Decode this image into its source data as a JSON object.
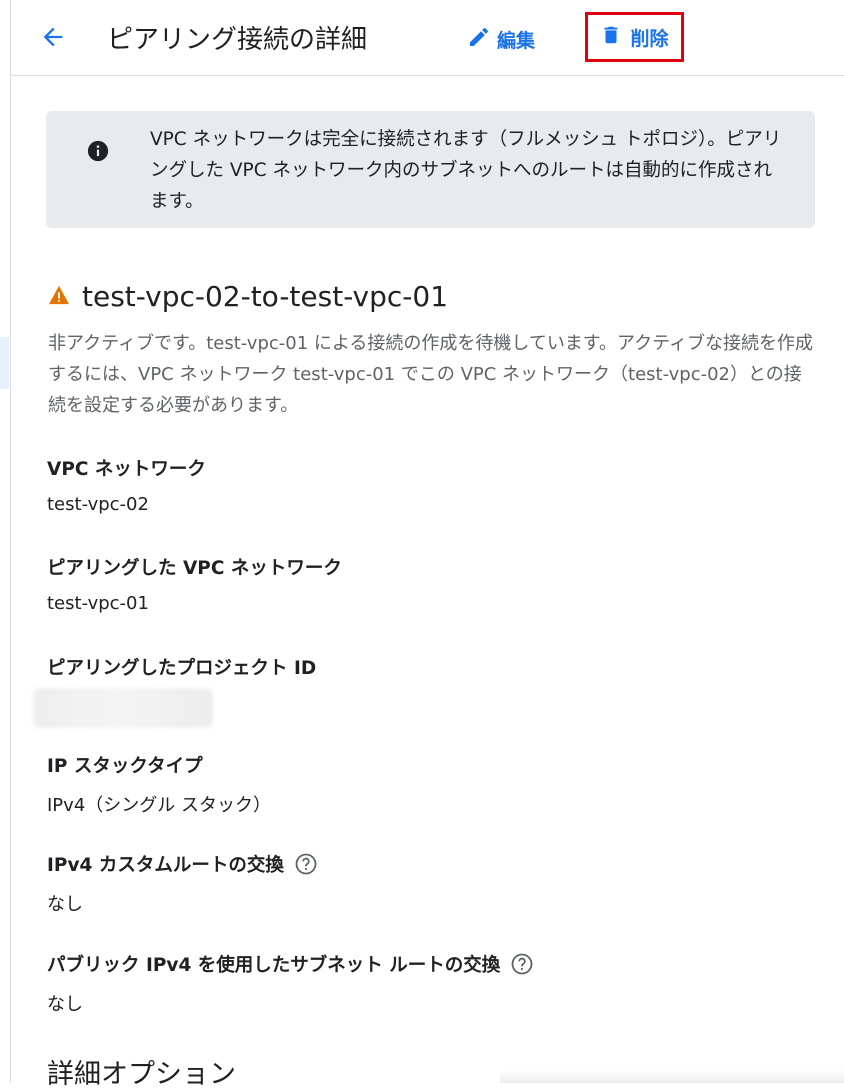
{
  "header": {
    "back_icon": "arrow-back-icon",
    "title": "ピアリング接続の詳細",
    "edit_label": "編集",
    "edit_icon": "pencil-icon",
    "delete_label": "削除",
    "delete_icon": "trash-icon"
  },
  "info_banner": {
    "icon": "info-icon",
    "text": "VPC ネットワークは完全に接続されます（フルメッシュ トポロジ）。ピアリングした VPC ネットワーク内のサブネットへのルートは自動的に作成されます。"
  },
  "connection": {
    "status_icon": "warning-icon",
    "name": "test-vpc-02-to-test-vpc-01",
    "status_text": "非アクティブです。test-vpc-01 による接続の作成を待機しています。アクティブな接続を作成するには、VPC ネットワーク test-vpc-01 でこの VPC ネットワーク（test-vpc-02）との接続を設定する必要があります。"
  },
  "fields": {
    "vpc_network": {
      "label": "VPC ネットワーク",
      "value": "test-vpc-02"
    },
    "peered_vpc_network": {
      "label": "ピアリングした VPC ネットワーク",
      "value": "test-vpc-01"
    },
    "peered_project_id": {
      "label": "ピアリングしたプロジェクト ID"
    },
    "ip_stack_type": {
      "label": "IP スタックタイプ",
      "value": "IPv4（シングル スタック）"
    },
    "ipv4_custom_routes": {
      "label": "IPv4 カスタムルートの交換",
      "value": "なし",
      "help_icon": "help-icon"
    },
    "public_ipv4_subnet_routes": {
      "label": "パブリック IPv4 を使用したサブネット ルートの交換",
      "value": "なし",
      "help_icon": "help-icon"
    }
  },
  "advanced_section": {
    "title": "詳細オプション"
  },
  "colors": {
    "accent": "#1a73e8",
    "highlight_border": "#e0000f",
    "warning": "#e37400",
    "banner_bg": "#e8eaed"
  }
}
